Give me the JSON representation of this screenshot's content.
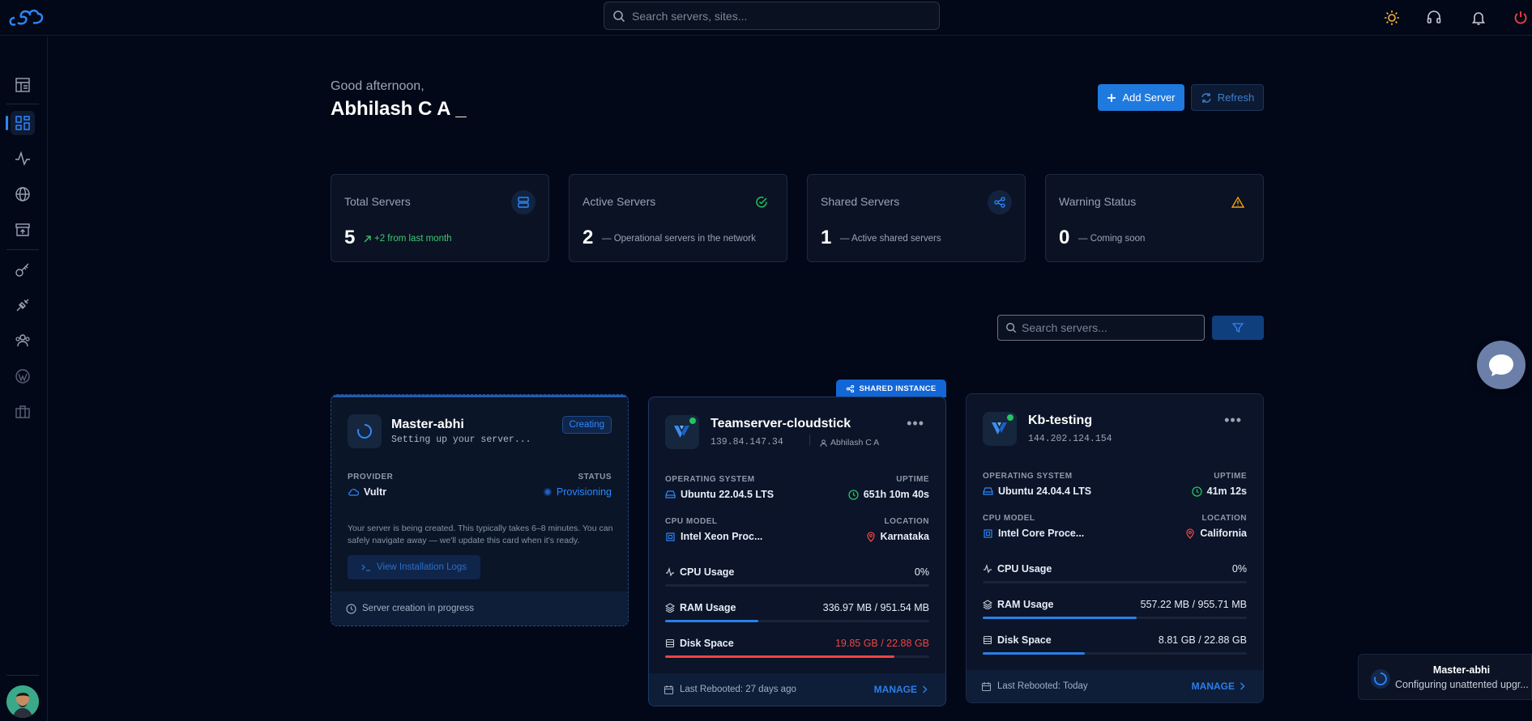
{
  "header": {
    "search_placeholder": "Search servers, sites...",
    "icons": [
      "sun-icon",
      "headset-icon",
      "bell-icon",
      "power-icon"
    ]
  },
  "sidebar": {
    "icons": [
      "dashboard-icon",
      "grid-icon",
      "activity-icon",
      "globe-icon",
      "archive-icon",
      "key-icon",
      "plug-icon",
      "users-icon",
      "wordpress-icon",
      "briefcase-icon"
    ],
    "active": "grid-icon"
  },
  "greeting": "Good afternoon,",
  "user_name": "Abhilash C A _",
  "actions": {
    "add_server": "Add Server",
    "refresh": "Refresh"
  },
  "stats": [
    {
      "label": "Total Servers",
      "value": "5",
      "note": "+2 from last month",
      "icon": "server-icon"
    },
    {
      "label": "Active Servers",
      "value": "2",
      "note": "— Operational servers in the network",
      "icon": "check-circle-icon"
    },
    {
      "label": "Shared Servers",
      "value": "1",
      "note": "— Active shared servers",
      "icon": "share-icon"
    },
    {
      "label": "Warning Status",
      "value": "0",
      "note": "— Coming soon",
      "icon": "warning-icon"
    }
  ],
  "server_search_placeholder": "Search servers...",
  "cards": {
    "creating": {
      "name": "Master-abhi",
      "subtitle": "Setting up your server...",
      "badge": "Creating",
      "provider_label": "PROVIDER",
      "provider": "Vultr",
      "status_label": "STATUS",
      "status": "Provisioning",
      "message": "Your server is being created. This typically takes 6–8 minutes. You can safely navigate away — we'll update this card when it's ready.",
      "logs_button": "View Installation Logs",
      "footer": "Server creation in progress"
    },
    "teamserver": {
      "shared_badge": "SHARED INSTANCE",
      "name": "Teamserver-cloudstick",
      "ip": "139.84.147.34",
      "owner": "Abhilash C A",
      "os_label": "OPERATING SYSTEM",
      "os": "Ubuntu 22.04.5 LTS",
      "uptime_label": "UPTIME",
      "uptime": "651h 10m 40s",
      "cpu_label": "CPU MODEL",
      "cpu": "Intel Xeon Proc...",
      "loc_label": "LOCATION",
      "location": "Karnataka",
      "cpu_usage_label": "CPU Usage",
      "cpu_usage": "0%",
      "cpu_fraction": 0,
      "ram_label": "RAM Usage",
      "ram": "336.97 MB / 951.54 MB",
      "ram_fraction": 0.354,
      "disk_label": "Disk Space",
      "disk": "19.85 GB / 22.88 GB",
      "disk_fraction": 0.868,
      "footer": "Last Rebooted: 27 days ago",
      "manage": "MANAGE"
    },
    "kbtesting": {
      "name": "Kb-testing",
      "ip": "144.202.124.154",
      "os_label": "OPERATING SYSTEM",
      "os": "Ubuntu 24.04.4 LTS",
      "uptime_label": "UPTIME",
      "uptime": "41m 12s",
      "cpu_label": "CPU MODEL",
      "cpu": "Intel Core Proce...",
      "loc_label": "LOCATION",
      "location": "California",
      "cpu_usage_label": "CPU Usage",
      "cpu_usage": "0%",
      "cpu_fraction": 0,
      "ram_label": "RAM Usage",
      "ram": "557.22 MB / 955.71 MB",
      "ram_fraction": 0.583,
      "disk_label": "Disk Space",
      "disk": "8.81 GB / 22.88 GB",
      "disk_fraction": 0.385,
      "footer": "Last Rebooted: Today",
      "manage": "MANAGE"
    }
  },
  "toast": {
    "title": "Master-abhi",
    "message": "Configuring unattented upgr..."
  },
  "colors": {
    "accent": "#1f7ae0",
    "success": "#22c55e",
    "danger": "#ef4444",
    "warning": "#f59e0b"
  }
}
